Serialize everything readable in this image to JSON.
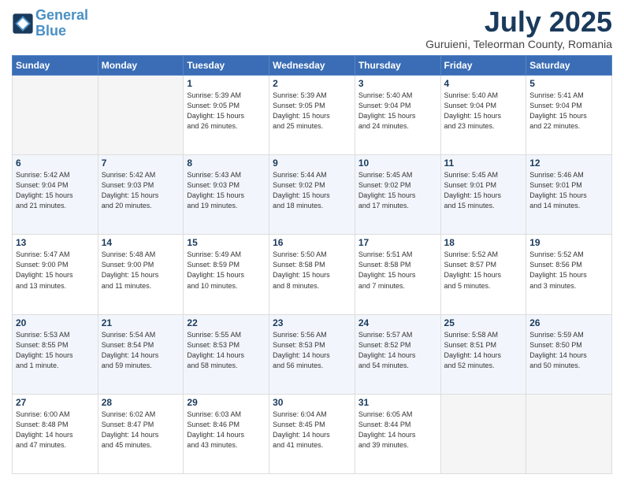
{
  "header": {
    "logo_line1": "General",
    "logo_line2": "Blue",
    "month": "July 2025",
    "location": "Guruieni, Teleorman County, Romania"
  },
  "weekdays": [
    "Sunday",
    "Monday",
    "Tuesday",
    "Wednesday",
    "Thursday",
    "Friday",
    "Saturday"
  ],
  "weeks": [
    [
      {
        "num": "",
        "info": ""
      },
      {
        "num": "",
        "info": ""
      },
      {
        "num": "1",
        "info": "Sunrise: 5:39 AM\nSunset: 9:05 PM\nDaylight: 15 hours\nand 26 minutes."
      },
      {
        "num": "2",
        "info": "Sunrise: 5:39 AM\nSunset: 9:05 PM\nDaylight: 15 hours\nand 25 minutes."
      },
      {
        "num": "3",
        "info": "Sunrise: 5:40 AM\nSunset: 9:04 PM\nDaylight: 15 hours\nand 24 minutes."
      },
      {
        "num": "4",
        "info": "Sunrise: 5:40 AM\nSunset: 9:04 PM\nDaylight: 15 hours\nand 23 minutes."
      },
      {
        "num": "5",
        "info": "Sunrise: 5:41 AM\nSunset: 9:04 PM\nDaylight: 15 hours\nand 22 minutes."
      }
    ],
    [
      {
        "num": "6",
        "info": "Sunrise: 5:42 AM\nSunset: 9:04 PM\nDaylight: 15 hours\nand 21 minutes."
      },
      {
        "num": "7",
        "info": "Sunrise: 5:42 AM\nSunset: 9:03 PM\nDaylight: 15 hours\nand 20 minutes."
      },
      {
        "num": "8",
        "info": "Sunrise: 5:43 AM\nSunset: 9:03 PM\nDaylight: 15 hours\nand 19 minutes."
      },
      {
        "num": "9",
        "info": "Sunrise: 5:44 AM\nSunset: 9:02 PM\nDaylight: 15 hours\nand 18 minutes."
      },
      {
        "num": "10",
        "info": "Sunrise: 5:45 AM\nSunset: 9:02 PM\nDaylight: 15 hours\nand 17 minutes."
      },
      {
        "num": "11",
        "info": "Sunrise: 5:45 AM\nSunset: 9:01 PM\nDaylight: 15 hours\nand 15 minutes."
      },
      {
        "num": "12",
        "info": "Sunrise: 5:46 AM\nSunset: 9:01 PM\nDaylight: 15 hours\nand 14 minutes."
      }
    ],
    [
      {
        "num": "13",
        "info": "Sunrise: 5:47 AM\nSunset: 9:00 PM\nDaylight: 15 hours\nand 13 minutes."
      },
      {
        "num": "14",
        "info": "Sunrise: 5:48 AM\nSunset: 9:00 PM\nDaylight: 15 hours\nand 11 minutes."
      },
      {
        "num": "15",
        "info": "Sunrise: 5:49 AM\nSunset: 8:59 PM\nDaylight: 15 hours\nand 10 minutes."
      },
      {
        "num": "16",
        "info": "Sunrise: 5:50 AM\nSunset: 8:58 PM\nDaylight: 15 hours\nand 8 minutes."
      },
      {
        "num": "17",
        "info": "Sunrise: 5:51 AM\nSunset: 8:58 PM\nDaylight: 15 hours\nand 7 minutes."
      },
      {
        "num": "18",
        "info": "Sunrise: 5:52 AM\nSunset: 8:57 PM\nDaylight: 15 hours\nand 5 minutes."
      },
      {
        "num": "19",
        "info": "Sunrise: 5:52 AM\nSunset: 8:56 PM\nDaylight: 15 hours\nand 3 minutes."
      }
    ],
    [
      {
        "num": "20",
        "info": "Sunrise: 5:53 AM\nSunset: 8:55 PM\nDaylight: 15 hours\nand 1 minute."
      },
      {
        "num": "21",
        "info": "Sunrise: 5:54 AM\nSunset: 8:54 PM\nDaylight: 14 hours\nand 59 minutes."
      },
      {
        "num": "22",
        "info": "Sunrise: 5:55 AM\nSunset: 8:53 PM\nDaylight: 14 hours\nand 58 minutes."
      },
      {
        "num": "23",
        "info": "Sunrise: 5:56 AM\nSunset: 8:53 PM\nDaylight: 14 hours\nand 56 minutes."
      },
      {
        "num": "24",
        "info": "Sunrise: 5:57 AM\nSunset: 8:52 PM\nDaylight: 14 hours\nand 54 minutes."
      },
      {
        "num": "25",
        "info": "Sunrise: 5:58 AM\nSunset: 8:51 PM\nDaylight: 14 hours\nand 52 minutes."
      },
      {
        "num": "26",
        "info": "Sunrise: 5:59 AM\nSunset: 8:50 PM\nDaylight: 14 hours\nand 50 minutes."
      }
    ],
    [
      {
        "num": "27",
        "info": "Sunrise: 6:00 AM\nSunset: 8:48 PM\nDaylight: 14 hours\nand 47 minutes."
      },
      {
        "num": "28",
        "info": "Sunrise: 6:02 AM\nSunset: 8:47 PM\nDaylight: 14 hours\nand 45 minutes."
      },
      {
        "num": "29",
        "info": "Sunrise: 6:03 AM\nSunset: 8:46 PM\nDaylight: 14 hours\nand 43 minutes."
      },
      {
        "num": "30",
        "info": "Sunrise: 6:04 AM\nSunset: 8:45 PM\nDaylight: 14 hours\nand 41 minutes."
      },
      {
        "num": "31",
        "info": "Sunrise: 6:05 AM\nSunset: 8:44 PM\nDaylight: 14 hours\nand 39 minutes."
      },
      {
        "num": "",
        "info": ""
      },
      {
        "num": "",
        "info": ""
      }
    ]
  ]
}
